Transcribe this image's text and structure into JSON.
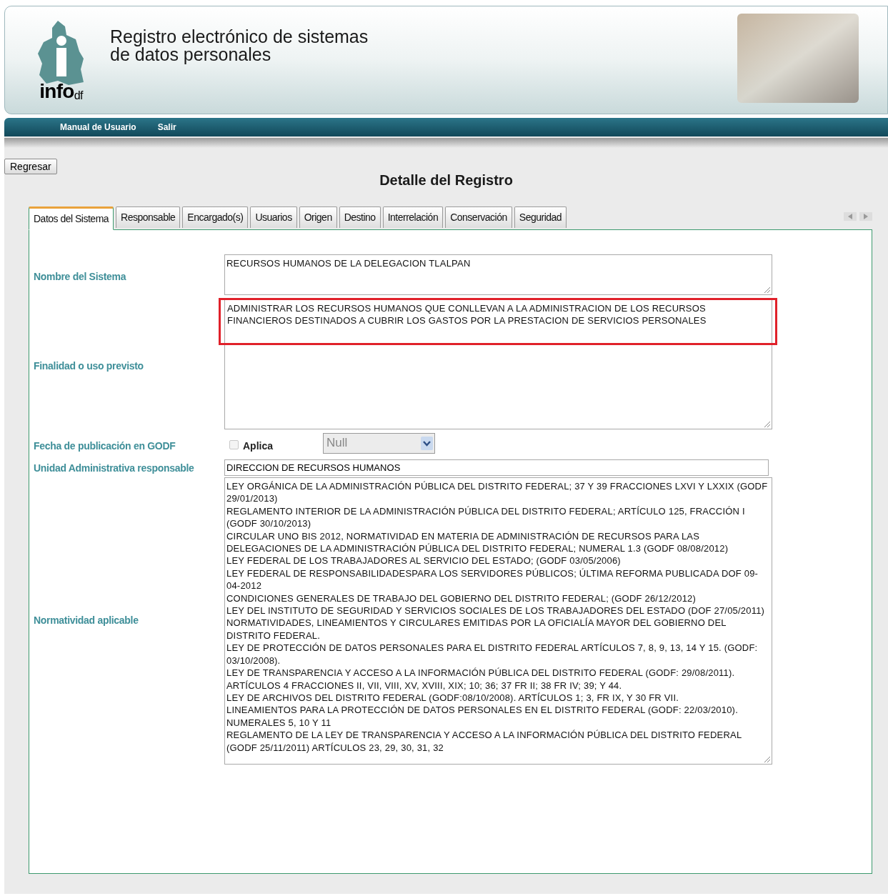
{
  "header": {
    "logo_text": "info",
    "logo_suffix": "df",
    "title_lines": [
      "Registro electrónico de sistemas",
      "de datos personales"
    ]
  },
  "nav": [
    {
      "label": "Manual de Usuario"
    },
    {
      "label": "Salir"
    }
  ],
  "back_button": "Regresar",
  "page_title": "Detalle del Registro",
  "tabs": [
    {
      "label": "Datos del Sistema",
      "selected": true
    },
    {
      "label": "Responsable",
      "selected": false
    },
    {
      "label": "Encargado(s)",
      "selected": false
    },
    {
      "label": "Usuarios",
      "selected": false
    },
    {
      "label": "Origen",
      "selected": false
    },
    {
      "label": "Destino",
      "selected": false
    },
    {
      "label": "Interrelación",
      "selected": false
    },
    {
      "label": "Conservación",
      "selected": false
    },
    {
      "label": "Seguridad",
      "selected": false
    }
  ],
  "fields": [
    {
      "kind": "textarea",
      "label": "Nombre del Sistema",
      "lines": [
        "RECURSOS HUMANOS DE LA DELEGACION TLALPAN"
      ],
      "highlighted": false
    },
    {
      "kind": "textarea",
      "label": "Finalidad o uso previsto",
      "lines": [
        "ADMINISTRAR LOS RECURSOS HUMANOS QUE CONLLEVAN A LA ADMINISTRACION DE LOS RECURSOS FINANCIEROS DESTINADOS A CUBRIR LOS GASTOS POR LA PRESTACION DE SERVICIOS PERSONALES"
      ],
      "highlighted": true
    },
    {
      "kind": "date",
      "label": "Fecha de publicación en GODF",
      "checkbox_label": "Aplica",
      "checked": false,
      "select_value": "Null"
    },
    {
      "kind": "input",
      "label": "Unidad Administrativa responsable",
      "value": "DIRECCION DE RECURSOS HUMANOS"
    },
    {
      "kind": "textarea",
      "label": "Normatividad aplicable",
      "highlighted": false,
      "lines": [
        "LEY ORGÁNICA DE LA ADMINISTRACIÓN PÚBLICA DEL DISTRITO FEDERAL; 37 Y 39 FRACCIONES LXVI Y LXXIX (GODF 29/01/2013)",
        "REGLAMENTO INTERIOR DE LA ADMINISTRACIÓN PÚBLICA DEL DISTRITO FEDERAL; ARTÍCULO 125, FRACCIÓN I (GODF 30/10/2013)",
        "CIRCULAR UNO BIS 2012, NORMATIVIDAD EN MATERIA DE ADMINISTRACIÓN DE RECURSOS PARA LAS DELEGACIONES DE LA ADMINISTRACIÓN PÚBLICA DEL DISTRITO FEDERAL; NUMERAL 1.3 (GODF 08/08/2012)",
        "LEY FEDERAL DE LOS TRABAJADORES AL SERVICIO DEL ESTADO; (GODF 03/05/2006)",
        "LEY FEDERAL DE RESPONSABILIDADESPARA LOS SERVIDORES PÚBLICOS; ÚLTIMA REFORMA PUBLICADA DOF 09-04-2012",
        "CONDICIONES GENERALES DE TRABAJO DEL GOBIERNO DEL DISTRITO FEDERAL; (GODF 26/12/2012)",
        "LEY DEL INSTITUTO DE SEGURIDAD Y SERVICIOS SOCIALES DE LOS TRABAJADORES DEL ESTADO (DOF 27/05/2011)",
        "NORMATIVIDADES, LINEAMIENTOS Y CIRCULARES EMITIDAS POR LA OFICIALÍA MAYOR DEL GOBIERNO DEL DISTRITO FEDERAL.",
        "LEY DE PROTECCIÓN DE DATOS PERSONALES PARA EL DISTRITO FEDERAL ARTÍCULOS 7, 8,  9,  13, 14 Y 15. (GODF: 03/10/2008).",
        "LEY DE TRANSPARENCIA Y ACCESO A LA INFORMACIÓN PÚBLICA DEL DISTRITO FEDERAL (GODF: 29/08/2011). ARTÍCULOS 4 FRACCIONES II, VII, VIII, XV, XVIII, XIX; 10; 36; 37 FR II; 38 FR IV; 39;  Y 44.",
        "LEY DE ARCHIVOS DEL DISTRITO FEDERAL (GODF:08/10/2008). ARTÍCULOS 1; 3, FR IX, Y 30 FR VII.",
        "LINEAMIENTOS PARA LA PROTECCIÓN DE DATOS PERSONALES EN EL DISTRITO FEDERAL (GODF: 22/03/2010). NUMERALES 5, 10 Y 11",
        "REGLAMENTO DE LA LEY DE TRANSPARENCIA Y ACCESO A LA INFORMACIÓN PÚBLICA DEL DISTRITO FEDERAL (GODF 25/11/2011) ARTÍCULOS 23, 29, 30, 31, 32"
      ]
    }
  ]
}
